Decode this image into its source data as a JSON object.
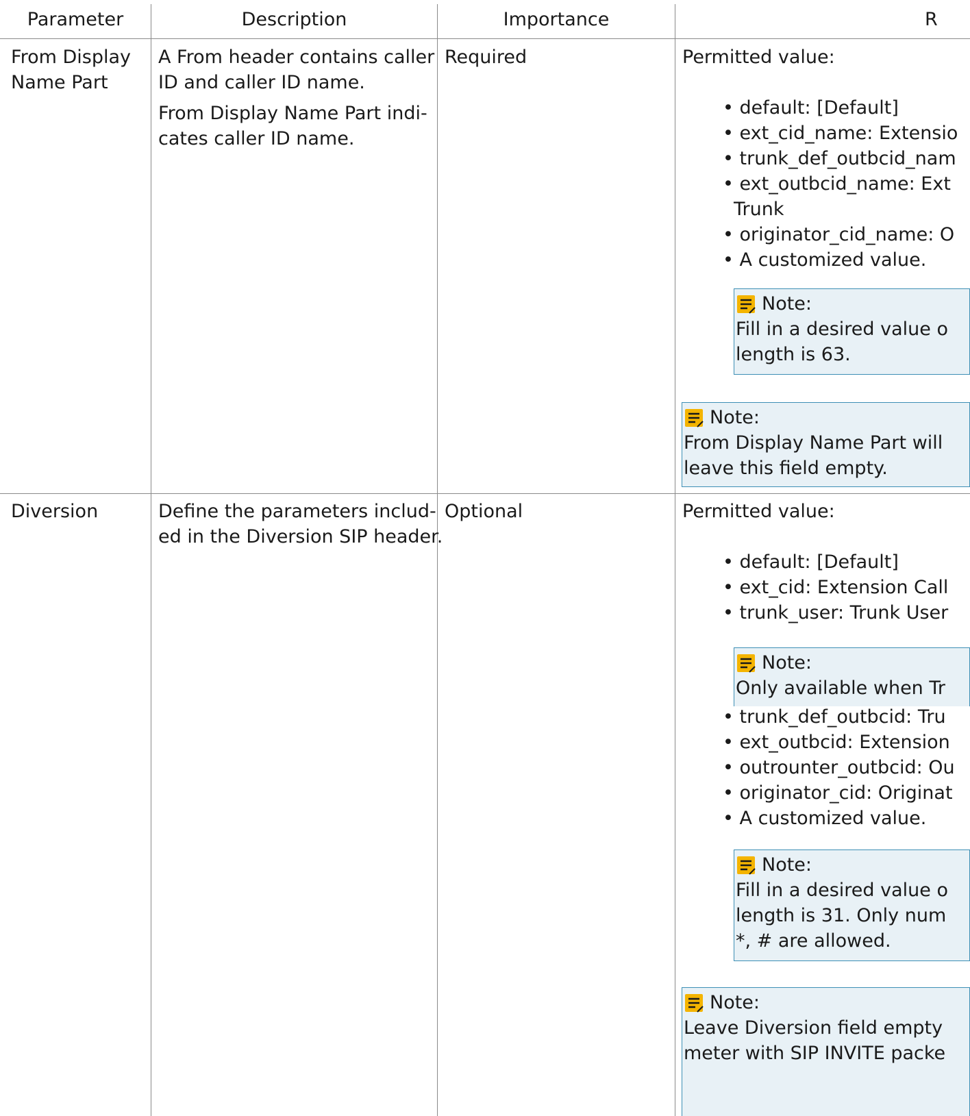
{
  "header": {
    "parameter": "Parameter",
    "description": "Description",
    "importance": "Importance",
    "remark": "R"
  },
  "rows": [
    {
      "parameter_lines": [
        "From Display",
        "Name Part"
      ],
      "description_p1": [
        "A From header contains caller",
        "ID and caller ID name."
      ],
      "description_p2": [
        "From Display Name Part indi-",
        "cates caller ID name."
      ],
      "importance": "Required",
      "remark_intro": "Permitted value:",
      "remark_items": [
        "default: [Default]",
        "ext_cid_name: Extensio",
        "trunk_def_outbcid_nam",
        "ext_outbcid_name: Ext"
      ],
      "remark_item_continuation": "Trunk",
      "remark_items_after": [
        "originator_cid_name: O",
        "A customized value."
      ],
      "inner_note": {
        "title": "Note:",
        "lines": [
          "Fill in a desired value o",
          "length is 63."
        ]
      },
      "outer_note": {
        "title": "Note:",
        "lines": [
          "From Display Name Part will",
          "leave this field empty."
        ]
      }
    },
    {
      "parameter_lines": [
        "Diversion"
      ],
      "description_p1": [
        "Define the parameters includ-",
        "ed in the Diversion SIP header."
      ],
      "importance": "Optional",
      "remark_intro": "Permitted value:",
      "remark_items": [
        "default: [Default]",
        "ext_cid: Extension Call",
        "trunk_user: Trunk User"
      ],
      "inner_note_1": {
        "title": "Note:",
        "lines": [
          "Only available when Tr"
        ]
      },
      "remark_items_after": [
        "trunk_def_outbcid: Tru",
        "ext_outbcid: Extension",
        "outrounter_outbcid: Ou",
        "originator_cid: Originat",
        "A customized value."
      ],
      "inner_note_2": {
        "title": "Note:",
        "lines": [
          "Fill in a desired value o",
          "length is 31. Only num",
          "*, # are allowed."
        ]
      },
      "outer_note": {
        "title": "Note:",
        "lines": [
          "Leave Diversion field empty",
          "meter with SIP INVITE packe"
        ]
      }
    }
  ],
  "colors": {
    "note_border": "#3d8fb5",
    "note_background": "#e8f1f6",
    "note_icon": "#f4b400",
    "grid": "#8a8a8a"
  },
  "icons": {
    "note": "note-icon"
  }
}
